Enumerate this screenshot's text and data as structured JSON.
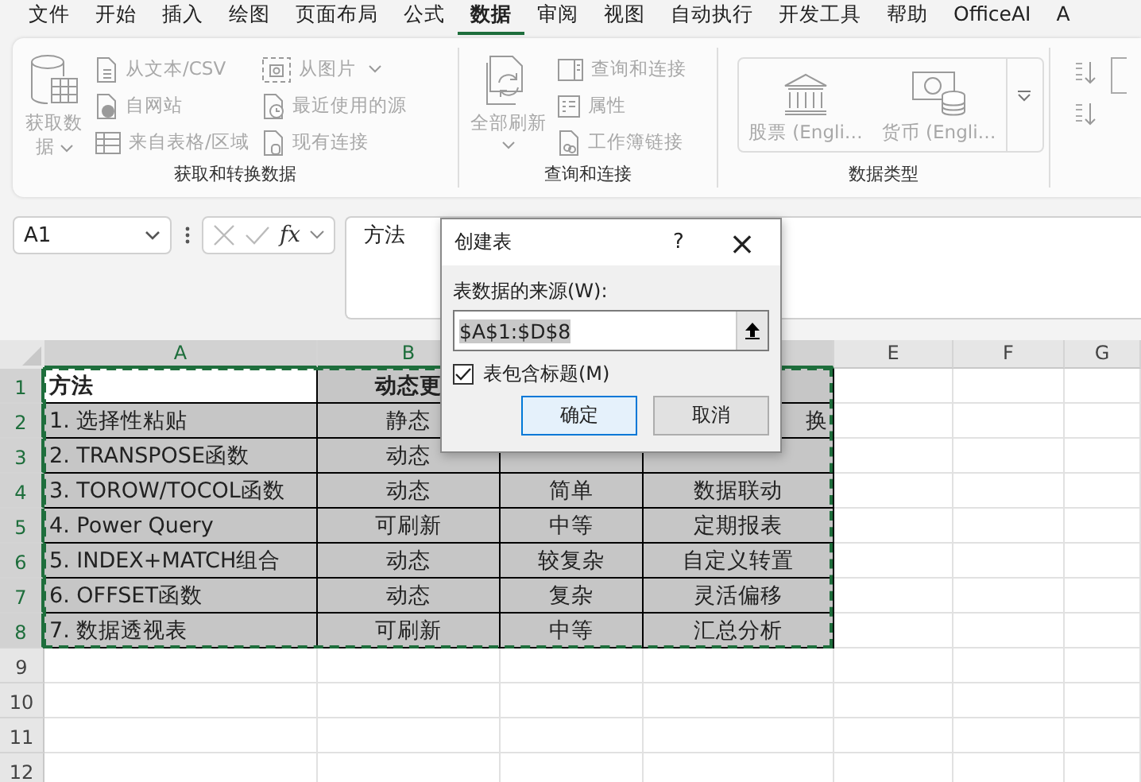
{
  "menu_tabs": [
    {
      "label": "文件",
      "selected": false
    },
    {
      "label": "开始",
      "selected": false
    },
    {
      "label": "插入",
      "selected": false
    },
    {
      "label": "绘图",
      "selected": false
    },
    {
      "label": "页面布局",
      "selected": false
    },
    {
      "label": "公式",
      "selected": false
    },
    {
      "label": "数据",
      "selected": true
    },
    {
      "label": "审阅",
      "selected": false
    },
    {
      "label": "视图",
      "selected": false
    },
    {
      "label": "自动执行",
      "selected": false
    },
    {
      "label": "开发工具",
      "selected": false
    },
    {
      "label": "帮助",
      "selected": false
    },
    {
      "label": "OfficeAI",
      "selected": false
    },
    {
      "label": "A",
      "selected": false
    }
  ],
  "ribbon": {
    "groups": [
      {
        "label": "获取和转换数据",
        "kind": "commands",
        "big": {
          "label": "获取数据",
          "kind": "database",
          "dropdown": true,
          "disabled": true
        },
        "items": [
          {
            "label": "从文本/CSV",
            "kind": "textfile",
            "dropdown": false,
            "disabled": true
          },
          {
            "label": "自网站",
            "kind": "web",
            "dropdown": false,
            "disabled": true
          },
          {
            "label": "来自表格/区域",
            "kind": "table",
            "dropdown": false,
            "disabled": true
          },
          {
            "label": "从图片",
            "kind": "picture",
            "dropdown": true,
            "disabled": true
          },
          {
            "label": "最近使用的源",
            "kind": "recent",
            "dropdown": false,
            "disabled": true
          },
          {
            "label": "现有连接",
            "kind": "connection",
            "dropdown": false,
            "disabled": true
          }
        ]
      },
      {
        "label": "查询和连接",
        "kind": "commands",
        "big": {
          "label": "全部刷新",
          "kind": "refresh",
          "dropdown": true,
          "disabled": true
        },
        "items": [
          {
            "label": "查询和连接",
            "kind": "queries",
            "dropdown": false,
            "disabled": true
          },
          {
            "label": "属性",
            "kind": "properties",
            "dropdown": false,
            "disabled": true
          },
          {
            "label": "工作簿链接",
            "kind": "links",
            "dropdown": false,
            "disabled": true
          }
        ]
      },
      {
        "label": "数据类型",
        "kind": "gallery",
        "items": [
          {
            "label": "股票 (Engli…",
            "kind": "bank",
            "disabled": true
          },
          {
            "label": "货币 (Engli…",
            "kind": "currency",
            "disabled": true
          }
        ]
      },
      {
        "kind": "sort"
      }
    ]
  },
  "formula_bar": {
    "name_box": "A1",
    "fx": "fx",
    "formula": "方法"
  },
  "sheet": {
    "marquee": true,
    "columns": [
      {
        "label": "A",
        "selected": true
      },
      {
        "label": "B",
        "selected": true
      },
      {},
      {
        "selected": true
      },
      {
        "label": "E",
        "selected": false
      },
      {
        "label": "F",
        "selected": false
      },
      {
        "label": "G",
        "selected": false
      }
    ],
    "row_headers": [
      {
        "label": "1",
        "selected": true
      },
      {
        "label": "2",
        "selected": true
      },
      {
        "label": "3",
        "selected": true
      },
      {
        "label": "4",
        "selected": true
      },
      {
        "label": "5",
        "selected": true
      },
      {
        "label": "6",
        "selected": true
      },
      {
        "label": "7",
        "selected": true
      },
      {
        "label": "8",
        "selected": true
      },
      {
        "label": "9",
        "selected": false
      },
      {
        "label": "10",
        "selected": false
      },
      {
        "label": "11",
        "selected": false
      },
      {
        "label": "12",
        "selected": false
      }
    ],
    "rows": [
      {
        "header": true,
        "cells": [
          {
            "text": "方法",
            "active": true
          },
          {
            "text": "动态更",
            "active": false
          },
          null,
          {}
        ]
      },
      {
        "header": false,
        "cells": [
          {
            "text": "1. 选择性粘贴",
            "active": false
          },
          {
            "text": "静态",
            "active": false
          },
          null,
          {
            "text": "换",
            "active": false,
            "partial": true
          }
        ]
      },
      {
        "header": false,
        "cells": [
          {
            "text": "2. TRANSPOSE函数",
            "active": false
          },
          {
            "text": "动态",
            "active": false
          },
          {},
          {}
        ]
      },
      {
        "header": false,
        "cells": [
          {
            "text": "3. TOROW/TOCOL函数",
            "active": false
          },
          {
            "text": "动态",
            "active": false
          },
          {
            "text": "简单",
            "active": false
          },
          {
            "text": "数据联动",
            "active": false
          }
        ]
      },
      {
        "header": false,
        "cells": [
          {
            "text": "4. Power Query",
            "active": false
          },
          {
            "text": "可刷新",
            "active": false
          },
          {
            "text": "中等",
            "active": false
          },
          {
            "text": "定期报表",
            "active": false
          }
        ]
      },
      {
        "header": false,
        "cells": [
          {
            "text": "5. INDEX+MATCH组合",
            "active": false
          },
          {
            "text": "动态",
            "active": false
          },
          {
            "text": "较复杂",
            "active": false
          },
          {
            "text": "自定义转置",
            "active": false
          }
        ]
      },
      {
        "header": false,
        "cells": [
          {
            "text": "6. OFFSET函数",
            "active": false
          },
          {
            "text": "动态",
            "active": false
          },
          {
            "text": "复杂",
            "active": false
          },
          {
            "text": "灵活偏移",
            "active": false
          }
        ]
      },
      {
        "header": false,
        "cells": [
          {
            "text": "7. 数据透视表",
            "active": false
          },
          {
            "text": "可刷新",
            "active": false
          },
          {
            "text": "中等",
            "active": false
          },
          {
            "text": "汇总分析",
            "active": false
          }
        ]
      }
    ]
  },
  "dialog": {
    "title": "创建表",
    "help": "?",
    "close": "×",
    "source_label": "表数据的来源(W):",
    "source_value": "$A$1:$D$8",
    "has_headers": {
      "label": "表包含标题(M)",
      "checked": true
    },
    "buttons": [
      {
        "label": "确定",
        "default": true
      },
      {
        "label": "取消",
        "default": false
      }
    ]
  }
}
